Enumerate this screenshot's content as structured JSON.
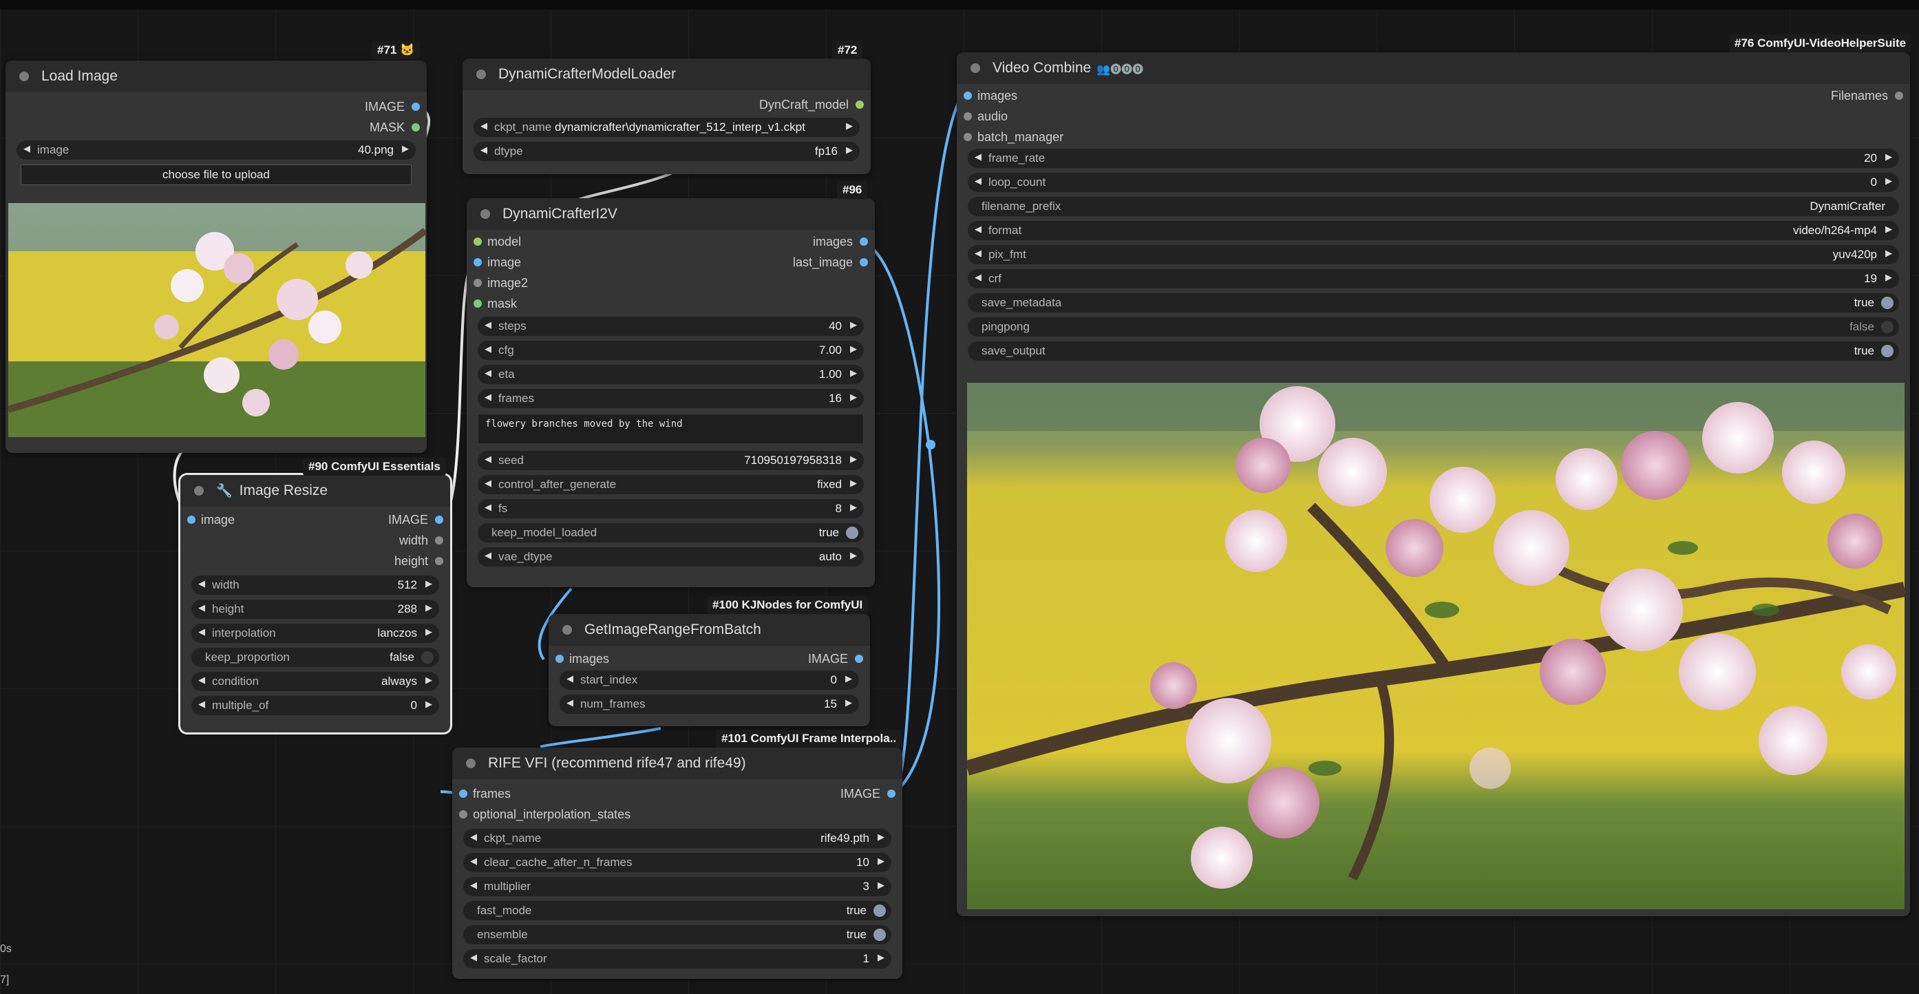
{
  "nodes": {
    "load_image": {
      "badge": "#71 🐱",
      "title": "Load Image",
      "outputs": [
        "IMAGE",
        "MASK"
      ],
      "image_widget": {
        "label": "image",
        "value": "40.png"
      },
      "upload_label": "choose file to upload"
    },
    "model_loader": {
      "badge": "#72",
      "title": "DynamiCrafterModelLoader",
      "output": "DynCraft_model",
      "ckpt": {
        "label": "ckpt_name",
        "value": "dynamicrafter\\dynamicrafter_512_interp_v1.ckpt"
      },
      "dtype": {
        "label": "dtype",
        "value": "fp16"
      }
    },
    "i2v": {
      "badge": "#96",
      "title": "DynamiCrafterI2V",
      "inputs": [
        "model",
        "image",
        "image2",
        "mask"
      ],
      "outputs": [
        "images",
        "last_image"
      ],
      "widgets": [
        {
          "label": "steps",
          "value": "40"
        },
        {
          "label": "cfg",
          "value": "7.00"
        },
        {
          "label": "eta",
          "value": "1.00"
        },
        {
          "label": "frames",
          "value": "16"
        }
      ],
      "prompt": "flowery branches moved by the wind",
      "widgets2": [
        {
          "label": "seed",
          "value": "710950197958318"
        },
        {
          "label": "control_after_generate",
          "value": "fixed"
        },
        {
          "label": "fs",
          "value": "8"
        }
      ],
      "toggle": {
        "label": "keep_model_loaded",
        "value": "true"
      },
      "vae": {
        "label": "vae_dtype",
        "value": "auto"
      }
    },
    "resize": {
      "badge": "#90 ComfyUI Essentials",
      "title": "Image Resize",
      "input": "image",
      "outputs": [
        "IMAGE",
        "width",
        "height"
      ],
      "widgets": [
        {
          "label": "width",
          "value": "512"
        },
        {
          "label": "height",
          "value": "288"
        },
        {
          "label": "interpolation",
          "value": "lanczos"
        }
      ],
      "toggle": {
        "label": "keep_proportion",
        "value": "false"
      },
      "widgets2": [
        {
          "label": "condition",
          "value": "always"
        },
        {
          "label": "multiple_of",
          "value": "0"
        }
      ]
    },
    "range": {
      "badge": "#100 KJNodes for ComfyUI",
      "title": "GetImageRangeFromBatch",
      "input": "images",
      "output": "IMAGE",
      "widgets": [
        {
          "label": "start_index",
          "value": "0"
        },
        {
          "label": "num_frames",
          "value": "15"
        }
      ]
    },
    "rife": {
      "badge": "#101 ComfyUI Frame Interpola..",
      "title": "RIFE VFI (recommend rife47 and rife49)",
      "inputs": [
        "frames",
        "optional_interpolation_states"
      ],
      "output": "IMAGE",
      "widgets": [
        {
          "label": "ckpt_name",
          "value": "rife49.pth"
        },
        {
          "label": "clear_cache_after_n_frames",
          "value": "10"
        },
        {
          "label": "multiplier",
          "value": "3"
        }
      ],
      "toggles": [
        {
          "label": "fast_mode",
          "value": "true"
        },
        {
          "label": "ensemble",
          "value": "true"
        }
      ],
      "scale": {
        "label": "scale_factor",
        "value": "1"
      }
    },
    "video": {
      "badge": "#76 ComfyUI-VideoHelperSuite",
      "title": "Video Combine",
      "title_icons": "👥⓿⓿⓿",
      "inputs": [
        "images",
        "audio",
        "batch_manager"
      ],
      "output": "Filenames",
      "widgets": [
        {
          "label": "frame_rate",
          "value": "20"
        },
        {
          "label": "loop_count",
          "value": "0"
        }
      ],
      "prefix": {
        "label": "filename_prefix",
        "value": "DynamiCrafter"
      },
      "widgets2": [
        {
          "label": "format",
          "value": "video/h264-mp4"
        },
        {
          "label": "pix_fmt",
          "value": "yuv420p"
        },
        {
          "label": "crf",
          "value": "19"
        }
      ],
      "toggles": [
        {
          "label": "save_metadata",
          "value": "true"
        },
        {
          "label": "pingpong",
          "value": "false"
        },
        {
          "label": "save_output",
          "value": "true"
        }
      ]
    }
  },
  "sidebar": {
    "line1": "0s",
    "line2": "7]"
  },
  "colors": {
    "image": "#64b5f6",
    "mask": "#81c784",
    "model": "#9ccc65",
    "canvas": "#171717",
    "node": "#353535"
  }
}
